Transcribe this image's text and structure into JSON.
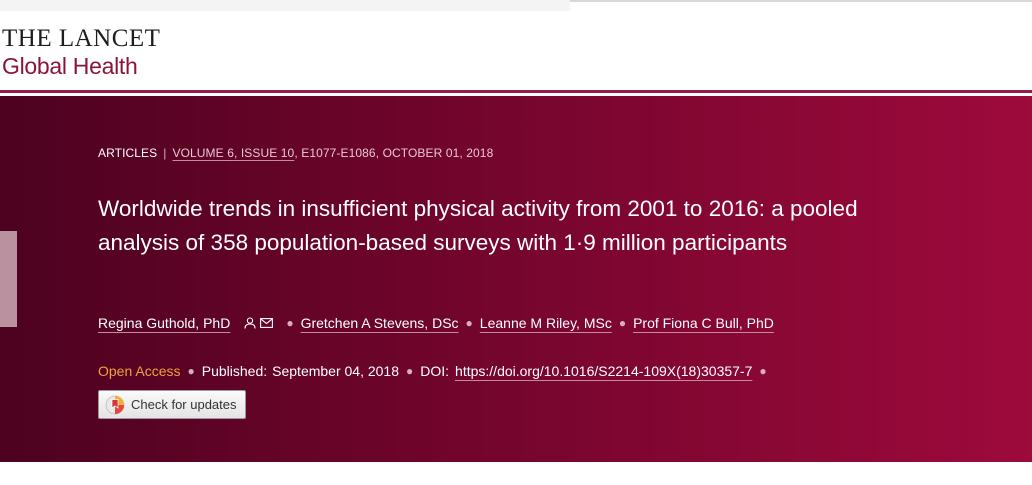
{
  "logo": {
    "line1": "THE LANCET",
    "line2": "Global Health"
  },
  "article": {
    "type": "ARTICLES",
    "volume_link": "VOLUME 6, ISSUE 10",
    "pages_date": ", E1077-E1086, OCTOBER 01, 2018",
    "title": "Worldwide trends in insufficient physical activity from 2001 to 2016: a pooled analysis of 358 population-based surveys with 1·9 million participants"
  },
  "authors": [
    {
      "name": "Regina Guthold, PhD"
    },
    {
      "name": "Gretchen A Stevens, DSc"
    },
    {
      "name": "Leanne M Riley, MSc"
    },
    {
      "name": "Prof Fiona C Bull, PhD"
    }
  ],
  "publication": {
    "open_access": "Open Access",
    "published_label": "Published:",
    "published_date": "September 04, 2018",
    "doi_label": "DOI:",
    "doi": "https://doi.org/10.1016/S2214-109X(18)30357-7"
  },
  "check_updates": {
    "label": "Check for updates"
  },
  "icons": {
    "person": "person-icon",
    "mail": "mail-icon",
    "crossmark": "crossmark-icon"
  },
  "colors": {
    "brand": "#8a1538",
    "hero_dark": "#4d0220",
    "hero_light": "#9d0a3c",
    "open_access": "#f0a141"
  }
}
